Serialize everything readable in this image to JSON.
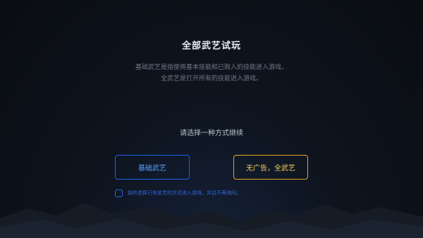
{
  "dialog": {
    "title": "全部武艺试玩",
    "description_line1": "基础武艺是指使用基本技能和已购入的技能进入游戏。",
    "description_line2": "全武艺是打开所有的技能进入游戏。",
    "prompt": "请选择一种方式继续"
  },
  "buttons": {
    "basic_label": "基础武艺",
    "full_label": "无广告，全武艺"
  },
  "remember": {
    "label": "始终选择已有武艺的方式进入游戏，并且不再询问。",
    "checked": false
  },
  "colors": {
    "basic_border": "#1f5ef0",
    "full_border": "#e5a624",
    "link_blue": "#2f67e0"
  }
}
